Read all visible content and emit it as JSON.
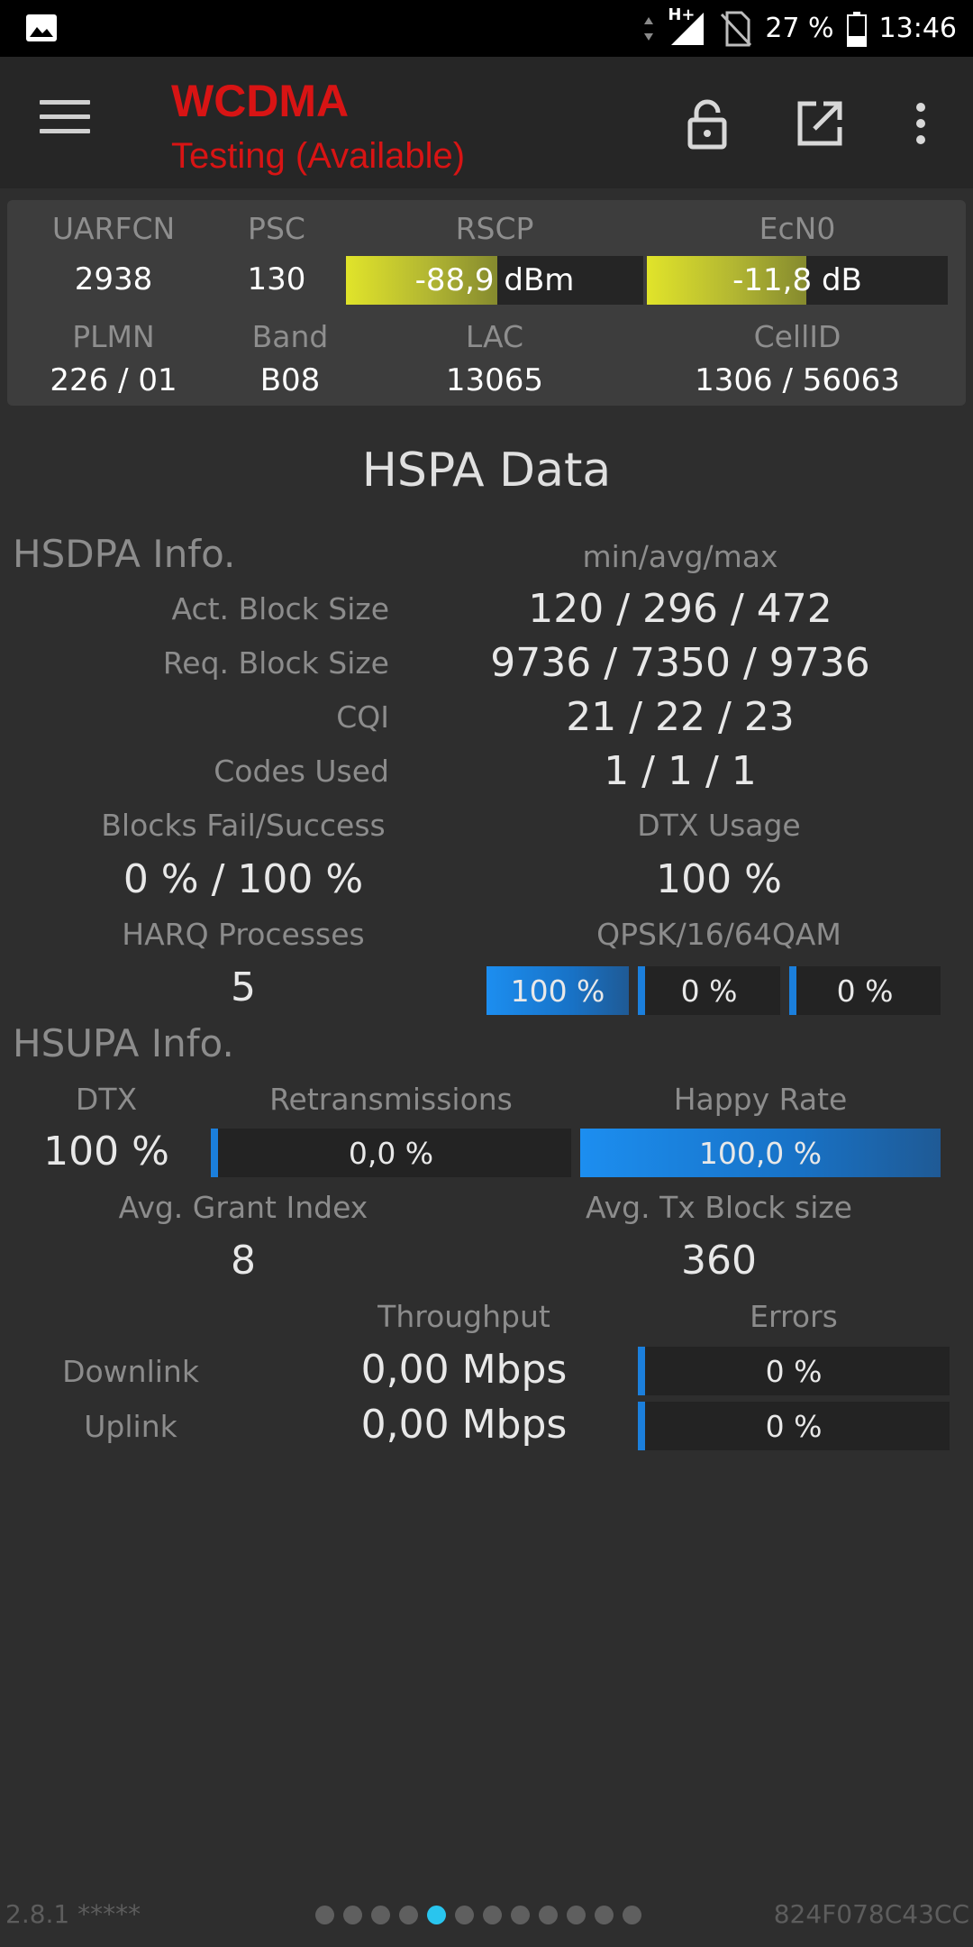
{
  "status_bar": {
    "network": "H+",
    "battery": "27 %",
    "time": "13:46",
    "icons": [
      "image-icon",
      "data-arrows-icon",
      "signal-icon",
      "no-sim-icon",
      "battery-icon"
    ]
  },
  "app_bar": {
    "title": "WCDMA",
    "subtitle": "Testing (Available)",
    "title_color": "#d81414",
    "icons": [
      "menu-icon",
      "lock-icon",
      "open-external-icon",
      "more-vert-icon"
    ]
  },
  "cell_info": {
    "labels": {
      "uarfcn": "UARFCN",
      "psc": "PSC",
      "rscp": "RSCP",
      "ecn0": "EcN0",
      "plmn": "PLMN",
      "band": "Band",
      "lac": "LAC",
      "cellid": "CellID"
    },
    "uarfcn": "2938",
    "psc": "130",
    "rscp": {
      "value": "-88,9",
      "unit": "dBm",
      "level": 0.51
    },
    "ecn0": {
      "value": "-11,8",
      "unit": "dB",
      "level": 0.53
    },
    "plmn": "226 / 01",
    "band": "B08",
    "lac": "13065",
    "cellid": "1306 / 56063"
  },
  "section_title": "HSPA Data",
  "hsdpa": {
    "heading": "HSDPA Info.",
    "stats_header": "min/avg/max",
    "rows": [
      {
        "label": "Act. Block Size",
        "value": "120 / 296 / 472"
      },
      {
        "label": "Req. Block Size",
        "value": "9736 / 7350 / 9736"
      },
      {
        "label": "CQI",
        "value": "21 / 22 / 23"
      },
      {
        "label": "Codes Used",
        "value": "1 / 1 / 1"
      }
    ],
    "blocks_label": "Blocks Fail/Success",
    "blocks_value": "0 % / 100 %",
    "dtx_label": "DTX Usage",
    "dtx_value": "100 %",
    "harq_label": "HARQ Processes",
    "harq_value": "5",
    "modulation_label": "QPSK/16/64QAM",
    "modulation": [
      {
        "text": "100 %",
        "level": 1.0
      },
      {
        "text": "0 %",
        "level": 0.0
      },
      {
        "text": "0 %",
        "level": 0.0
      }
    ]
  },
  "hsupa": {
    "heading": "HSUPA Info.",
    "dtx_label": "DTX",
    "dtx_value": "100 %",
    "retrans_label": "Retransmissions",
    "retrans": {
      "text": "0,0 %",
      "level": 0.0
    },
    "happy_label": "Happy Rate",
    "happy": {
      "text": "100,0 %",
      "level": 1.0
    },
    "grant_label": "Avg. Grant Index",
    "grant_value": "8",
    "txblock_label": "Avg. Tx Block size",
    "txblock_value": "360"
  },
  "throughput": {
    "throughput_header": "Throughput",
    "errors_header": "Errors",
    "downlink": {
      "label": "Downlink",
      "value": "0,00 Mbps",
      "errors": {
        "text": "0 %",
        "level": 0.0
      }
    },
    "uplink": {
      "label": "Uplink",
      "value": "0,00 Mbps",
      "errors": {
        "text": "0 %",
        "level": 0.0
      }
    }
  },
  "footer": {
    "version": "2.8.1 *****",
    "device_id": "824F078C43CC",
    "page_count": 12,
    "active_page": 5
  }
}
